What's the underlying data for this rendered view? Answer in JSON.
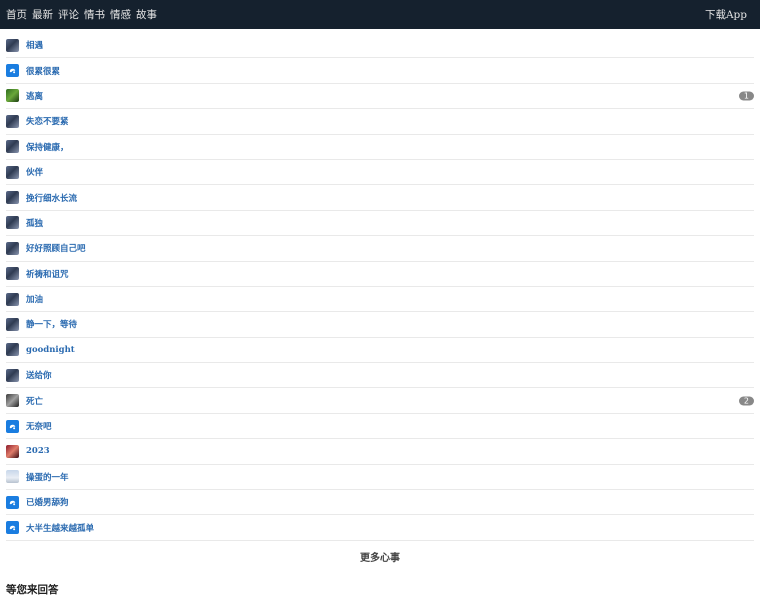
{
  "topbar": {
    "nav": [
      "首页",
      "最新",
      "评论",
      "情书",
      "情感",
      "故事"
    ],
    "download": "下载App"
  },
  "posts": [
    {
      "title": "相遇",
      "avatar": "photo",
      "count": ""
    },
    {
      "title": "很累很累",
      "avatar": "blue",
      "count": ""
    },
    {
      "title": "逃离",
      "avatar": "green",
      "count": "1"
    },
    {
      "title": "失恋不要紧",
      "avatar": "photo",
      "count": ""
    },
    {
      "title": "保持健康，",
      "avatar": "photo",
      "count": ""
    },
    {
      "title": "伙伴",
      "avatar": "photo",
      "count": ""
    },
    {
      "title": "挽行细水长流",
      "avatar": "photo",
      "count": ""
    },
    {
      "title": "孤独",
      "avatar": "photo",
      "count": ""
    },
    {
      "title": "好好照顾自己吧",
      "avatar": "photo",
      "count": ""
    },
    {
      "title": "祈祷和诅咒",
      "avatar": "photo",
      "count": ""
    },
    {
      "title": "加油",
      "avatar": "photo",
      "count": ""
    },
    {
      "title": "静一下，等待",
      "avatar": "photo",
      "count": ""
    },
    {
      "title": "goodnight",
      "avatar": "photo",
      "count": ""
    },
    {
      "title": "送给你",
      "avatar": "photo",
      "count": ""
    },
    {
      "title": "死亡",
      "avatar": "dark",
      "count": "2"
    },
    {
      "title": "无奈吧",
      "avatar": "blue",
      "count": ""
    },
    {
      "title": "2023",
      "avatar": "red",
      "count": ""
    },
    {
      "title": "操蛋的一年",
      "avatar": "sky",
      "count": ""
    },
    {
      "title": "已婚男舔狗",
      "avatar": "blue",
      "count": ""
    },
    {
      "title": "大半生越来越孤单",
      "avatar": "blue",
      "count": ""
    }
  ],
  "more_label": "更多心事",
  "section_title": "等您来回答"
}
